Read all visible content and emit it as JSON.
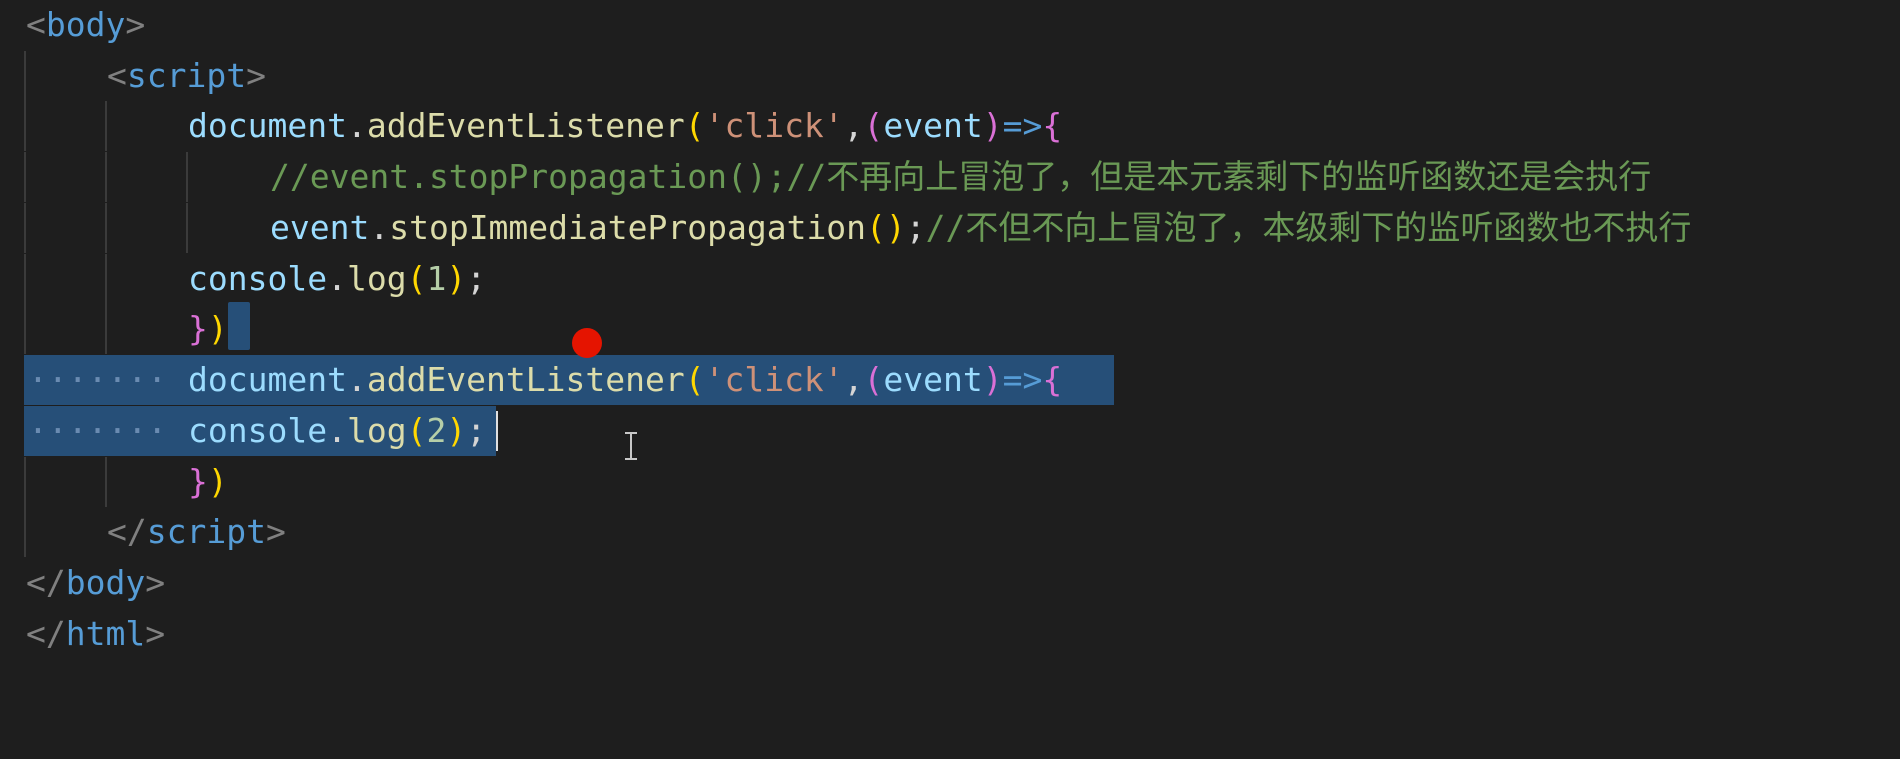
{
  "editor": {
    "lines": {
      "l1": {
        "lt": "<",
        "tag": "body",
        "gt": ">"
      },
      "l2": {
        "lt": "<",
        "tag": "script",
        "gt": ">"
      },
      "l3": {
        "obj": "document",
        "dot": ".",
        "fn": "addEventListener",
        "p1o": "(",
        "str": "'click'",
        "comma": ",",
        "p2o": "(",
        "param": "event",
        "p2c": ")",
        "arrow": "=>",
        "brace": "{"
      },
      "l4": {
        "comment_code": "//event.stopPropagation();//",
        "comment_cjk": "不再向上冒泡了，但是本元素剩下的监听函数还是会执行"
      },
      "l5": {
        "obj": "event",
        "dot": ".",
        "fn": "stopImmediatePropagation",
        "parens": "()",
        "semi": ";",
        "comment_code": "//",
        "comment_cjk": "不但不向上冒泡了，本级剩下的监听函数也不执行"
      },
      "l6": {
        "obj": "console",
        "dot": ".",
        "fn": "log",
        "po": "(",
        "num": "1",
        "pc": ")",
        "semi": ";"
      },
      "l7": {
        "brace": "}",
        "paren": ")"
      },
      "l8": {
        "dots": "·······",
        "obj": "document",
        "dot": ".",
        "fn": "addEventListener",
        "p1o": "(",
        "str": "'click'",
        "comma": ",",
        "p2o": "(",
        "param": "event",
        "p2c": ")",
        "arrow": "=>",
        "brace": "{"
      },
      "l9": {
        "dots": "·······",
        "obj": "console",
        "dot": ".",
        "fn": "log",
        "po": "(",
        "num": "2",
        "pc": ")",
        "semi": ";"
      },
      "l10": {
        "brace": "}",
        "paren": ")"
      },
      "l11": {
        "lt": "</",
        "tag": "script",
        "gt": ">"
      },
      "l12": {
        "lt": "</",
        "tag": "body",
        "gt": ">"
      },
      "l13": {
        "lt": "</",
        "tag": "html",
        "gt": ">"
      }
    }
  },
  "colors": {
    "background": "#1e1e1e",
    "selection": "#264f78",
    "breakpoint": "#e51400"
  }
}
